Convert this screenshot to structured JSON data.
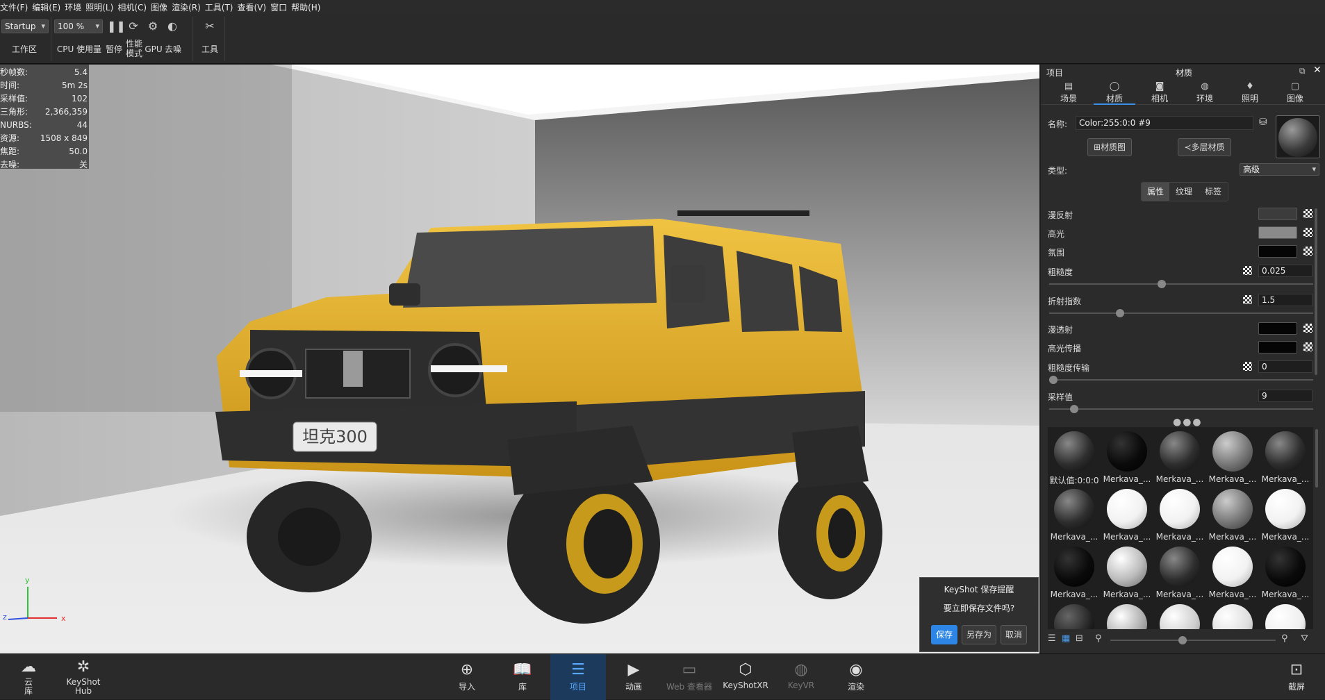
{
  "menu": [
    "文件(F)",
    "编辑(E)",
    "环境",
    "照明(L)",
    "相机(C)",
    "图像",
    "渲染(R)",
    "工具(T)",
    "查看(V)",
    "窗口",
    "帮助(H)"
  ],
  "toolbar": {
    "workspace_value": "Startup",
    "workspace_label": "工作区",
    "zoom_value": "100 %",
    "cpu_label": "CPU 使用量",
    "pause_label": "暂停",
    "perf_label_1": "性能",
    "perf_label_2": "模式",
    "gpu_label": "GPU",
    "denoise_label": "去噪",
    "tools_label": "工具"
  },
  "stats": [
    {
      "k": "秒帧数:",
      "v": "5.4"
    },
    {
      "k": "时间:",
      "v": "5m 2s"
    },
    {
      "k": "采样值:",
      "v": "102"
    },
    {
      "k": "三角形:",
      "v": "2,366,359"
    },
    {
      "k": "NURBS:",
      "v": "44"
    },
    {
      "k": "资源:",
      "v": "1508 x 849"
    },
    {
      "k": "焦距:",
      "v": "50.0"
    },
    {
      "k": "去噪:",
      "v": "关"
    }
  ],
  "car": {
    "plate": "坦克300",
    "body_color": "#e7b22a"
  },
  "axes": {
    "y": "y",
    "x": "x",
    "z": "z"
  },
  "notify": {
    "title": "KeyShot 保存提醒",
    "message": "要立即保存文件吗?",
    "save": "保存",
    "save_as": "另存为",
    "cancel": "取消"
  },
  "panel": {
    "project_label": "项目",
    "title": "材质",
    "tabs": [
      {
        "label": "场景",
        "icon": "scene-icon"
      },
      {
        "label": "材质",
        "icon": "material-icon"
      },
      {
        "label": "相机",
        "icon": "camera-icon"
      },
      {
        "label": "环境",
        "icon": "environment-icon"
      },
      {
        "label": "照明",
        "icon": "lighting-icon"
      },
      {
        "label": "图像",
        "icon": "image-icon"
      }
    ],
    "name_label": "名称:",
    "name_value": "Color:255:0:0 #9",
    "material_graph": "材质图",
    "multilayer": "多层材质",
    "type_label": "类型:",
    "type_value": "高级",
    "subtabs": [
      "属性",
      "纹理",
      "标签"
    ],
    "props": {
      "diffuse": "漫反射",
      "specular": "高光",
      "ambient": "氛围",
      "roughness": "粗糙度",
      "roughness_value": "0.025",
      "ior": "折射指数",
      "ior_value": "1.5",
      "diffuse_trans": "漫透射",
      "specular_trans": "高光传播",
      "roughness_trans": "粗糙度传输",
      "roughness_trans_value": "0",
      "samples": "采样值",
      "samples_value": "9"
    },
    "library": [
      {
        "label": "默认值:0:0:0",
        "tone": "dark"
      },
      {
        "label": "Merkava_...",
        "tone": "black"
      },
      {
        "label": "Merkava_...",
        "tone": "dark"
      },
      {
        "label": "Merkava_...",
        "tone": "mid"
      },
      {
        "label": "Merkava_...",
        "tone": "dark"
      },
      {
        "label": "Merkava_...",
        "tone": "dark"
      },
      {
        "label": "Merkava_...",
        "tone": "white"
      },
      {
        "label": "Merkava_...",
        "tone": "white"
      },
      {
        "label": "Merkava_...",
        "tone": "mid"
      },
      {
        "label": "Merkava_...",
        "tone": "white"
      },
      {
        "label": "Merkava_...",
        "tone": "black"
      },
      {
        "label": "Merkava_...",
        "tone": "light"
      },
      {
        "label": "Merkava_...",
        "tone": "dark"
      },
      {
        "label": "Merkava_...",
        "tone": "white"
      },
      {
        "label": "Merkava_...",
        "tone": "black"
      }
    ]
  },
  "bottom": [
    {
      "label_1": "云",
      "label_2": "库",
      "icon": "cloud-library-icon"
    },
    {
      "label_1": "KeyShot",
      "label_2": "Hub",
      "icon": "keyshot-hub-icon"
    },
    {
      "label_1": "导入",
      "icon": "import-icon"
    },
    {
      "label_1": "库",
      "icon": "library-icon"
    },
    {
      "label_1": "项目",
      "icon": "project-icon"
    },
    {
      "label_1": "动画",
      "icon": "animation-icon"
    },
    {
      "label_1": "Web 查看器",
      "icon": "web-viewer-icon"
    },
    {
      "label_1": "KeyShotXR",
      "icon": "keyshotxr-icon"
    },
    {
      "label_1": "KeyVR",
      "icon": "keyvr-icon"
    },
    {
      "label_1": "渲染",
      "icon": "render-icon"
    },
    {
      "label_1": "截屏",
      "icon": "screenshot-icon"
    }
  ]
}
